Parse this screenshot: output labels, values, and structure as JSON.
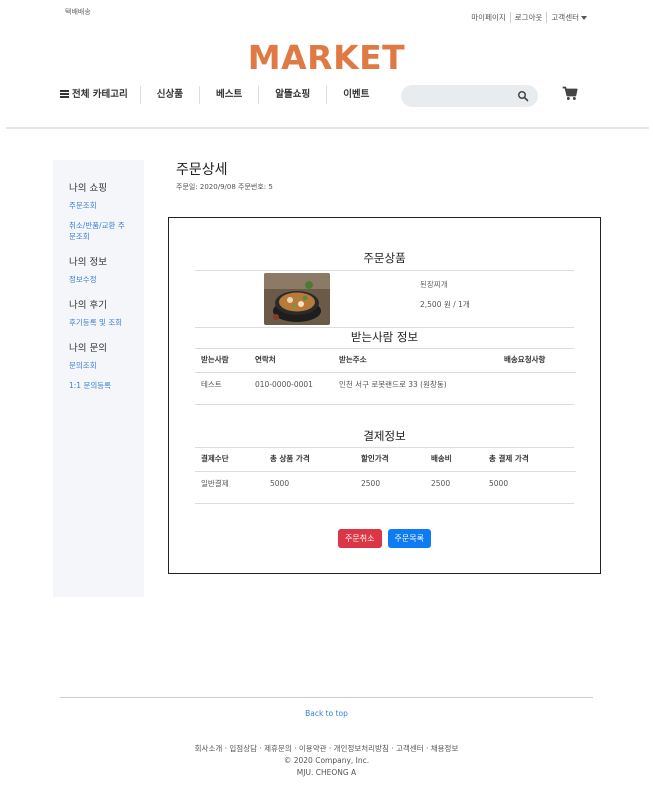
{
  "header": {
    "shipping_label": "택배배송",
    "top_links": [
      "마이페이지",
      "로그아웃",
      "고객센터"
    ],
    "logo": "MARKET",
    "nav": {
      "all_categories": "전체 카테고리",
      "items": [
        "신상품",
        "베스트",
        "알뜰쇼핑",
        "이벤트"
      ]
    },
    "search": {
      "placeholder": "",
      "value": ""
    },
    "icons": {
      "search": "search-icon",
      "cart": "cart-icon",
      "menu": "hamburger-icon"
    }
  },
  "sidebar": {
    "groups": [
      {
        "title": "나의 쇼핑",
        "links": [
          "주문조회",
          "취소/반품/교환 주문조회"
        ]
      },
      {
        "title": "나의 정보",
        "links": [
          "정보수정"
        ]
      },
      {
        "title": "나의 후기",
        "links": [
          "후기등록 및 조회"
        ]
      },
      {
        "title": "나의 문의",
        "links": [
          "문의조회",
          "1:1 문의등록"
        ]
      }
    ]
  },
  "main": {
    "title": "주문상세",
    "order_meta": "주문일: 2020/9/08 주문번호: 5",
    "product_section": {
      "title": "주문상품",
      "name": "된장찌개",
      "price_qty": "2,500 원 / 1개"
    },
    "recipient_section": {
      "title": "받는사람 정보",
      "headers": [
        "받는사람",
        "연락처",
        "받는주소",
        "배송요청사항"
      ],
      "row": [
        "테스트",
        "010-0000-0001",
        "인천 서구 로봇랜드로 33 (원창동)",
        ""
      ]
    },
    "payment_section": {
      "title": "결제정보",
      "headers": [
        "결제수단",
        "총 상품 가격",
        "할인가격",
        "배송비",
        "총 결제 가격"
      ],
      "row": [
        "일반결제",
        "5000",
        "2500",
        "2500",
        "5000"
      ]
    },
    "buttons": {
      "cancel": "주문취소",
      "list": "주문목록"
    }
  },
  "footer": {
    "back_to_top": "Back to top",
    "links": "회사소개 · 입점상담 · 제휴문의 · 이용약관 · 개인정보처리방침 · 고객센터 · 채용정보",
    "copyright": "© 2020 Company, Inc.",
    "credit": "MJU. CHEONG A"
  },
  "colors": {
    "logo": "#e07a45",
    "link": "#3a7fd5",
    "cancel_button": "#dc3545",
    "list_button": "#0d7bf3",
    "sidebar_bg": "#f4f6f9"
  }
}
